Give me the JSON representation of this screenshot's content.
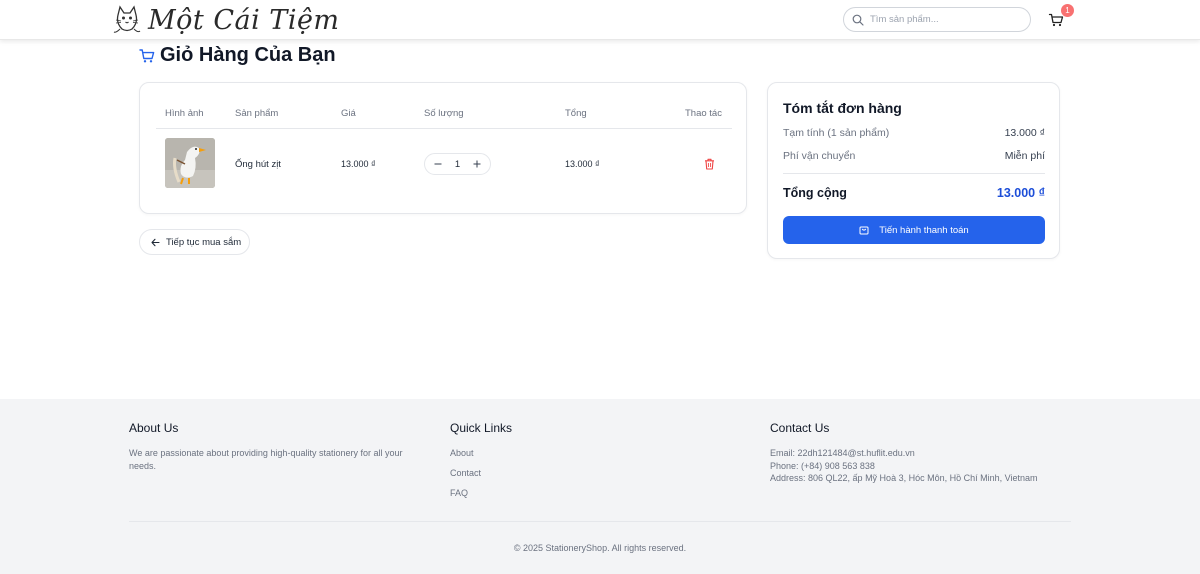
{
  "header": {
    "logo_text": "Một Cái Tiệm",
    "search_placeholder": "Tìm sản phẩm...",
    "cart_count": "1"
  },
  "page": {
    "title": "Giỏ Hàng Của Bạn"
  },
  "cart": {
    "columns": [
      "Hình ảnh",
      "Sản phẩm",
      "Giá",
      "Số lượng",
      "Tổng",
      "Thao tác"
    ],
    "items": [
      {
        "name": "Ống hút zịt",
        "price": "13.000 ₫",
        "quantity": "1",
        "total": "13.000 ₫"
      }
    ]
  },
  "continue_label": "Tiếp tục mua sắm",
  "summary": {
    "title": "Tóm tắt đơn hàng",
    "subtotal_label": "Tạm tính (1 sản phẩm)",
    "subtotal_value": "13.000 ₫",
    "shipping_label": "Phí vận chuyển",
    "shipping_value": "Miễn phí",
    "total_label": "Tổng cộng",
    "total_value": "13.000 ₫",
    "checkout_label": "Tiến hành thanh toán"
  },
  "footer": {
    "about_title": "About Us",
    "about_text": "We are passionate about providing high-quality stationery for all your needs.",
    "links_title": "Quick Links",
    "links": [
      "About",
      "Contact",
      "FAQ"
    ],
    "contact_title": "Contact Us",
    "email": "Email: 22dh121484@st.huflit.edu.vn",
    "phone": "Phone: (+84) 908 563 838",
    "address": "Address: 806 QL22, ấp Mỹ Hoà 3, Hóc Môn, Hồ Chí Minh, Vietnam",
    "copyright": "© 2025 StationeryShop. All rights reserved."
  },
  "colors": {
    "primary": "#2563eb",
    "total": "#1d4ed8",
    "badge": "#f87171",
    "delete": "#ef4444"
  }
}
